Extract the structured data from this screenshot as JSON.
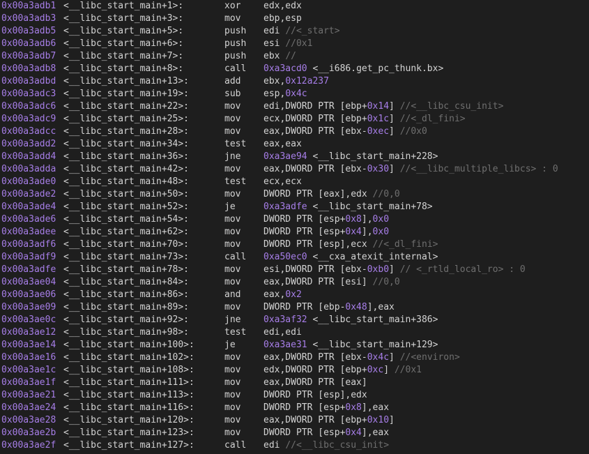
{
  "rows": [
    {
      "addr": "0x00a3adb1",
      "sym": "<__libc_start_main+1>:",
      "mn": "xor",
      "ops": [
        [
          "edx,edx",
          "t"
        ]
      ]
    },
    {
      "addr": "0x00a3adb3",
      "sym": "<__libc_start_main+3>:",
      "mn": "mov",
      "ops": [
        [
          "ebp,esp",
          "t"
        ]
      ]
    },
    {
      "addr": "0x00a3adb5",
      "sym": "<__libc_start_main+5>:",
      "mn": "push",
      "ops": [
        [
          "edi ",
          "t"
        ],
        [
          "//<_start>",
          "c"
        ]
      ]
    },
    {
      "addr": "0x00a3adb6",
      "sym": "<__libc_start_main+6>:",
      "mn": "push",
      "ops": [
        [
          "esi ",
          "t"
        ],
        [
          "//0x1",
          "c"
        ]
      ]
    },
    {
      "addr": "0x00a3adb7",
      "sym": "<__libc_start_main+7>:",
      "mn": "push",
      "ops": [
        [
          "ebx ",
          "t"
        ],
        [
          "//",
          "c"
        ]
      ]
    },
    {
      "addr": "0x00a3adb8",
      "sym": "<__libc_start_main+8>:",
      "mn": "call",
      "ops": [
        [
          "0xa3acd0",
          "n"
        ],
        [
          " <__i686.get_pc_thunk.bx>",
          "t"
        ]
      ]
    },
    {
      "addr": "0x00a3adbd",
      "sym": "<__libc_start_main+13>:",
      "mn": "add",
      "ops": [
        [
          "ebx,",
          "t"
        ],
        [
          "0x12a237",
          "n"
        ]
      ]
    },
    {
      "addr": "0x00a3adc3",
      "sym": "<__libc_start_main+19>:",
      "mn": "sub",
      "ops": [
        [
          "esp,",
          "t"
        ],
        [
          "0x4c",
          "n"
        ]
      ]
    },
    {
      "addr": "0x00a3adc6",
      "sym": "<__libc_start_main+22>:",
      "mn": "mov",
      "ops": [
        [
          "edi,DWORD PTR [ebp+",
          "t"
        ],
        [
          "0x14",
          "n"
        ],
        [
          "] ",
          "t"
        ],
        [
          "//<__libc_csu_init>",
          "c"
        ]
      ]
    },
    {
      "addr": "0x00a3adc9",
      "sym": "<__libc_start_main+25>:",
      "mn": "mov",
      "ops": [
        [
          "ecx,DWORD PTR [ebp+",
          "t"
        ],
        [
          "0x1c",
          "n"
        ],
        [
          "] ",
          "t"
        ],
        [
          "//<_dl_fini>",
          "c"
        ]
      ]
    },
    {
      "addr": "0x00a3adcc",
      "sym": "<__libc_start_main+28>:",
      "mn": "mov",
      "ops": [
        [
          "eax,DWORD PTR [ebx-",
          "t"
        ],
        [
          "0xec",
          "n"
        ],
        [
          "] ",
          "t"
        ],
        [
          "//0x0",
          "c"
        ]
      ]
    },
    {
      "addr": "0x00a3add2",
      "sym": "<__libc_start_main+34>:",
      "mn": "test",
      "ops": [
        [
          "eax,eax",
          "t"
        ]
      ]
    },
    {
      "addr": "0x00a3add4",
      "sym": "<__libc_start_main+36>:",
      "mn": "jne",
      "ops": [
        [
          "0xa3ae94",
          "n"
        ],
        [
          " <__libc_start_main+228>",
          "t"
        ]
      ]
    },
    {
      "addr": "0x00a3adda",
      "sym": "<__libc_start_main+42>:",
      "mn": "mov",
      "ops": [
        [
          "eax,DWORD PTR [ebx-",
          "t"
        ],
        [
          "0x30",
          "n"
        ],
        [
          "] ",
          "t"
        ],
        [
          "//<__libc_multiple_libcs> : 0",
          "c"
        ]
      ]
    },
    {
      "addr": "0x00a3ade0",
      "sym": "<__libc_start_main+48>:",
      "mn": "test",
      "ops": [
        [
          "ecx,ecx",
          "t"
        ]
      ]
    },
    {
      "addr": "0x00a3ade2",
      "sym": "<__libc_start_main+50>:",
      "mn": "mov",
      "ops": [
        [
          "DWORD PTR [eax],edx ",
          "t"
        ],
        [
          "//0,0",
          "c"
        ]
      ]
    },
    {
      "addr": "0x00a3ade4",
      "sym": "<__libc_start_main+52>:",
      "mn": "je",
      "ops": [
        [
          "0xa3adfe",
          "n"
        ],
        [
          " <__libc_start_main+78>",
          "t"
        ]
      ]
    },
    {
      "addr": "0x00a3ade6",
      "sym": "<__libc_start_main+54>:",
      "mn": "mov",
      "ops": [
        [
          "DWORD PTR [esp+",
          "t"
        ],
        [
          "0x8",
          "n"
        ],
        [
          "],",
          "t"
        ],
        [
          "0x0",
          "n"
        ]
      ]
    },
    {
      "addr": "0x00a3adee",
      "sym": "<__libc_start_main+62>:",
      "mn": "mov",
      "ops": [
        [
          "DWORD PTR [esp+",
          "t"
        ],
        [
          "0x4",
          "n"
        ],
        [
          "],",
          "t"
        ],
        [
          "0x0",
          "n"
        ]
      ]
    },
    {
      "addr": "0x00a3adf6",
      "sym": "<__libc_start_main+70>:",
      "mn": "mov",
      "ops": [
        [
          "DWORD PTR [esp],ecx ",
          "t"
        ],
        [
          "//<_dl_fini>",
          "c"
        ]
      ]
    },
    {
      "addr": "0x00a3adf9",
      "sym": "<__libc_start_main+73>:",
      "mn": "call",
      "ops": [
        [
          "0xa50ec0",
          "n"
        ],
        [
          " <__cxa_atexit_internal>",
          "t"
        ]
      ]
    },
    {
      "addr": "0x00a3adfe",
      "sym": "<__libc_start_main+78>:",
      "mn": "mov",
      "ops": [
        [
          "esi,DWORD PTR [ebx-",
          "t"
        ],
        [
          "0xb0",
          "n"
        ],
        [
          "] ",
          "t"
        ],
        [
          "// <_rtld_local_ro> : 0",
          "c"
        ]
      ]
    },
    {
      "addr": "0x00a3ae04",
      "sym": "<__libc_start_main+84>:",
      "mn": "mov",
      "ops": [
        [
          "eax,DWORD PTR [esi] ",
          "t"
        ],
        [
          "//0,0",
          "c"
        ]
      ]
    },
    {
      "addr": "0x00a3ae06",
      "sym": "<__libc_start_main+86>:",
      "mn": "and",
      "ops": [
        [
          "eax,",
          "t"
        ],
        [
          "0x2",
          "n"
        ]
      ]
    },
    {
      "addr": "0x00a3ae09",
      "sym": "<__libc_start_main+89>:",
      "mn": "mov",
      "ops": [
        [
          "DWORD PTR [ebp-",
          "t"
        ],
        [
          "0x48",
          "n"
        ],
        [
          "],eax",
          "t"
        ]
      ]
    },
    {
      "addr": "0x00a3ae0c",
      "sym": "<__libc_start_main+92>:",
      "mn": "jne",
      "ops": [
        [
          "0xa3af32",
          "n"
        ],
        [
          " <__libc_start_main+386>",
          "t"
        ]
      ]
    },
    {
      "addr": "0x00a3ae12",
      "sym": "<__libc_start_main+98>:",
      "mn": "test",
      "ops": [
        [
          "edi,edi",
          "t"
        ]
      ]
    },
    {
      "addr": "0x00a3ae14",
      "sym": "<__libc_start_main+100>:",
      "mn": "je",
      "ops": [
        [
          "0xa3ae31",
          "n"
        ],
        [
          " <__libc_start_main+129>",
          "t"
        ]
      ]
    },
    {
      "addr": "0x00a3ae16",
      "sym": "<__libc_start_main+102>:",
      "mn": "mov",
      "ops": [
        [
          "eax,DWORD PTR [ebx-",
          "t"
        ],
        [
          "0x4c",
          "n"
        ],
        [
          "] ",
          "t"
        ],
        [
          "//<environ>",
          "c"
        ]
      ]
    },
    {
      "addr": "0x00a3ae1c",
      "sym": "<__libc_start_main+108>:",
      "mn": "mov",
      "ops": [
        [
          "edx,DWORD PTR [ebp+",
          "t"
        ],
        [
          "0xc",
          "n"
        ],
        [
          "] ",
          "t"
        ],
        [
          "//0x1",
          "c"
        ]
      ]
    },
    {
      "addr": "0x00a3ae1f",
      "sym": "<__libc_start_main+111>:",
      "mn": "mov",
      "ops": [
        [
          "eax,DWORD PTR [eax]",
          "t"
        ]
      ]
    },
    {
      "addr": "0x00a3ae21",
      "sym": "<__libc_start_main+113>:",
      "mn": "mov",
      "ops": [
        [
          "DWORD PTR [esp],edx",
          "t"
        ]
      ]
    },
    {
      "addr": "0x00a3ae24",
      "sym": "<__libc_start_main+116>:",
      "mn": "mov",
      "ops": [
        [
          "DWORD PTR [esp+",
          "t"
        ],
        [
          "0x8",
          "n"
        ],
        [
          "],eax",
          "t"
        ]
      ]
    },
    {
      "addr": "0x00a3ae28",
      "sym": "<__libc_start_main+120>:",
      "mn": "mov",
      "ops": [
        [
          "eax,DWORD PTR [ebp+",
          "t"
        ],
        [
          "0x10",
          "n"
        ],
        [
          "]",
          "t"
        ]
      ]
    },
    {
      "addr": "0x00a3ae2b",
      "sym": "<__libc_start_main+123>:",
      "mn": "mov",
      "ops": [
        [
          "DWORD PTR [esp+",
          "t"
        ],
        [
          "0x4",
          "n"
        ],
        [
          "],eax",
          "t"
        ]
      ]
    },
    {
      "addr": "0x00a3ae2f",
      "sym": "<__libc_start_main+127>:",
      "mn": "call",
      "ops": [
        [
          "edi ",
          "t"
        ],
        [
          "//<__libc_csu_init>",
          "c"
        ]
      ]
    }
  ],
  "colors": {
    "background": "#1e1e1e",
    "text": "#d4d4d4",
    "number": "#a77ee8",
    "comment": "#6f6f6f"
  }
}
